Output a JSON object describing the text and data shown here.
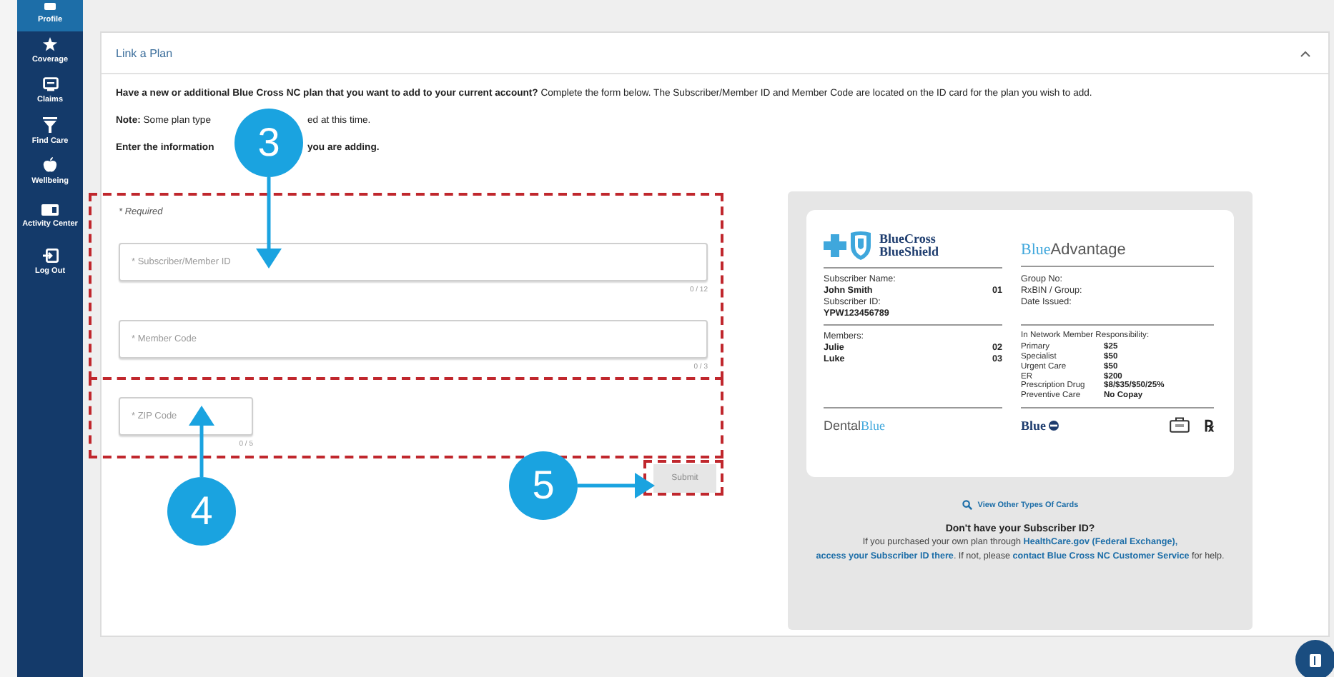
{
  "sidebar": {
    "items": [
      {
        "label": "Profile",
        "selected": true
      },
      {
        "label": "Coverage",
        "selected": false
      },
      {
        "label": "Claims",
        "selected": false
      },
      {
        "label": "Find Care",
        "selected": false
      },
      {
        "label": "Wellbeing",
        "selected": false
      },
      {
        "label": "Activity Center",
        "selected": false
      },
      {
        "label": "Log Out",
        "selected": false
      }
    ]
  },
  "panel": {
    "title": "Link a Plan",
    "expanded": true,
    "intro": "**Have a new or additional Blue Cross NC plan that you want to add to your current account?** Complete the form below. The Subscriber/Member ID and Member Code are located on the ID card for the plan you wish to add.",
    "note_lines": [
      {
        "before": "**Note:** Some plan type",
        "after": "ed at this time."
      },
      {
        "before": "**Enter the information**",
        "after": "**you are adding.**"
      }
    ]
  },
  "form": {
    "required_note": "* Required",
    "fields": [
      {
        "placeholder": "* Subscriber/Member ID",
        "counter": "0 / 12"
      },
      {
        "placeholder": "* Member Code",
        "counter": "0 / 3"
      },
      {
        "placeholder": "* ZIP Code",
        "counter": "0 / 5"
      }
    ],
    "submit": {
      "label": "Submit",
      "disabled": true
    }
  },
  "id_card": {
    "brand_lines": [
      "BlueCross",
      "BlueShield"
    ],
    "product": [
      "Blue",
      "Advantage"
    ],
    "left_top": [
      {
        "label": "Subscriber Name:"
      },
      {
        "value": "John Smith",
        "code": "01"
      },
      {
        "label": "Subscriber ID:"
      },
      {
        "value": "YPW123456789"
      }
    ],
    "right_top": [
      "Group No:",
      "RxBIN / Group:",
      "Date Issued:"
    ],
    "members_label": "Members:",
    "members": [
      {
        "name": "Julie",
        "code": "02"
      },
      {
        "name": "Luke",
        "code": "03"
      }
    ],
    "benefits_title": "In Network Member Responsibility:",
    "benefits": [
      {
        "label": "Primary",
        "value": "$25"
      },
      {
        "label": "Specialist",
        "value": "$50"
      },
      {
        "label": "Urgent Care",
        "value": "$50"
      },
      {
        "label": "ER",
        "value": "$200"
      },
      {
        "label": "Prescription Drug",
        "value": "$8/$35/$50/25%"
      },
      {
        "label": "Preventive Care",
        "value": "No Copay"
      }
    ],
    "dental": [
      "Dental",
      "Blue"
    ],
    "footer_brand": "Blue",
    "rx": "℞"
  },
  "help": {
    "view_cards_link": "View Other Types Of Cards",
    "question": "Don't have your Subscriber ID?",
    "segments": [
      {
        "kind": "text",
        "text": "If you purchased your own plan through "
      },
      {
        "kind": "link",
        "text": "HealthCare.gov (Federal Exchange),"
      },
      {
        "kind": "link",
        "text": "access your Subscriber ID there"
      },
      {
        "kind": "text",
        "text": ". If not, please "
      },
      {
        "kind": "link",
        "text": "contact Blue Cross NC Customer"
      },
      {
        "kind": "link",
        "text": "Service"
      },
      {
        "kind": "text",
        "text": " for help."
      }
    ]
  },
  "callouts": [
    {
      "number": "3"
    },
    {
      "number": "4"
    },
    {
      "number": "5"
    }
  ]
}
